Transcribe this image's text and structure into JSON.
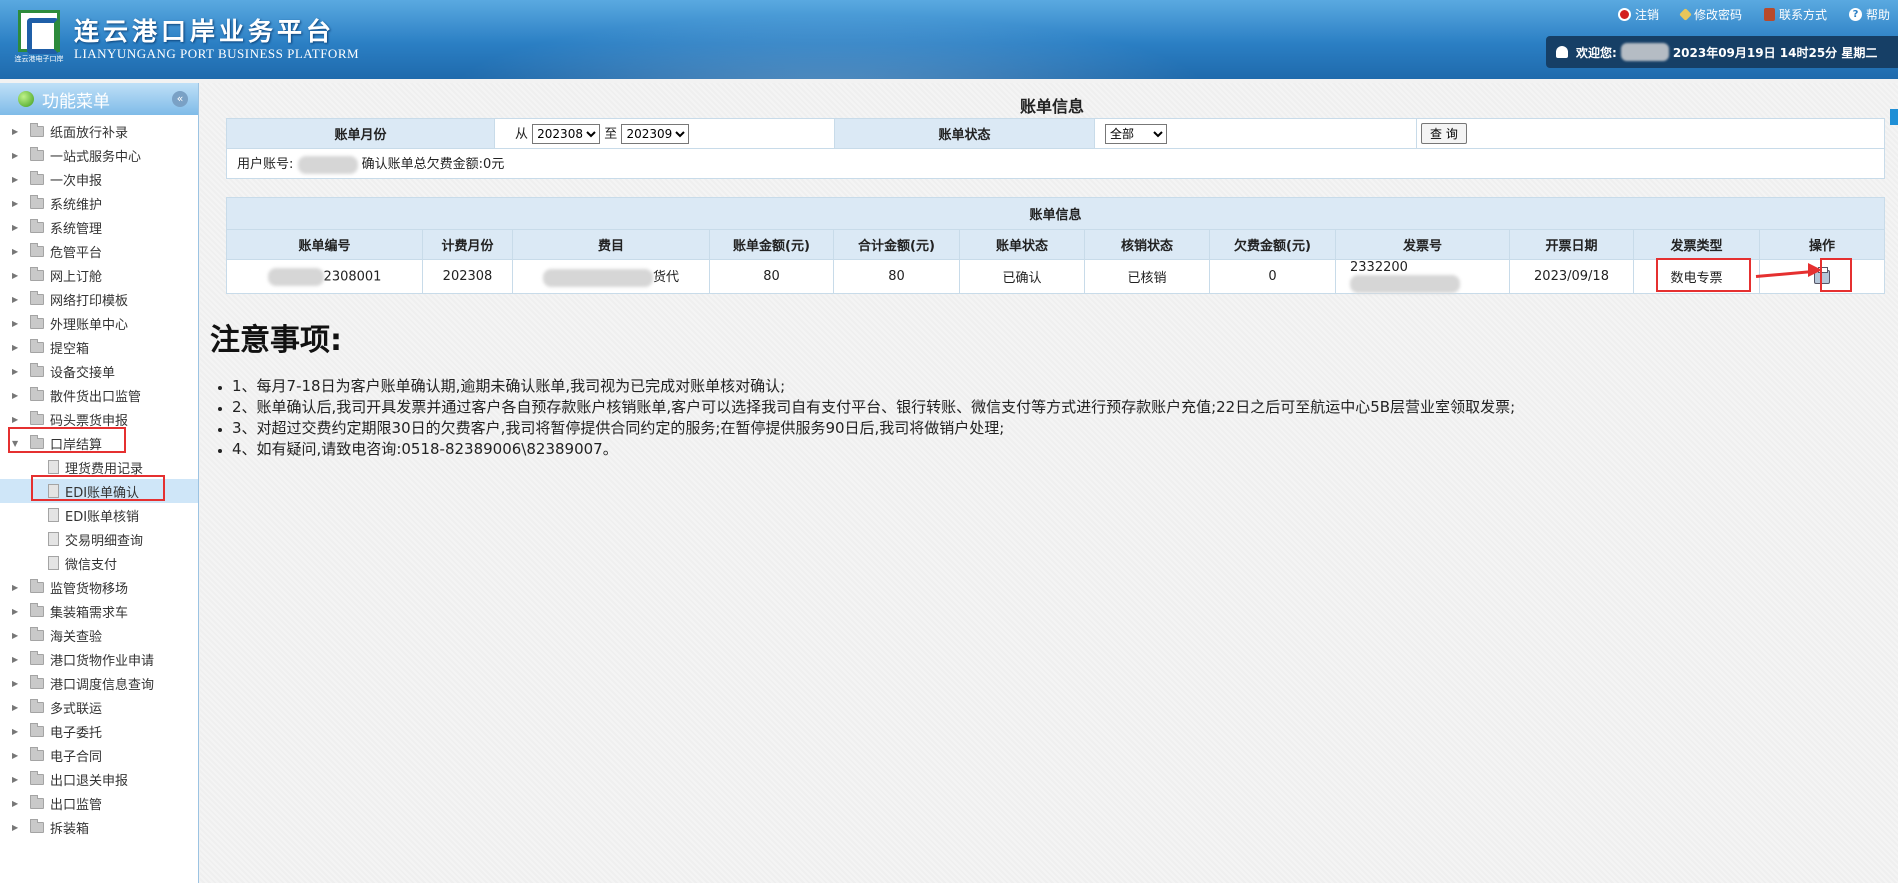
{
  "header": {
    "title_cn": "连云港口岸业务平台",
    "title_en": "LIANYUNGANG PORT BUSINESS PLATFORM",
    "logo_caption": "连云港电子口岸",
    "nav": [
      {
        "label": "注销",
        "icon": "logout-icon"
      },
      {
        "label": "修改密码",
        "icon": "key-icon"
      },
      {
        "label": "联系方式",
        "icon": "book-icon"
      },
      {
        "label": "帮助",
        "icon": "help-icon"
      }
    ],
    "welcome_label": "欢迎您:",
    "datetime": "2023年09月19日 14时25分  星期二"
  },
  "sidebar": {
    "title": "功能菜单",
    "items": [
      {
        "label": "纸面放行补录"
      },
      {
        "label": "一站式服务中心"
      },
      {
        "label": "一次申报"
      },
      {
        "label": "系统维护"
      },
      {
        "label": "系统管理"
      },
      {
        "label": "危管平台"
      },
      {
        "label": "网上订舱"
      },
      {
        "label": "网络打印模板"
      },
      {
        "label": "外理账单中心"
      },
      {
        "label": "提空箱"
      },
      {
        "label": "设备交接单"
      },
      {
        "label": "散件货出口监管"
      },
      {
        "label": "码头票货申报"
      },
      {
        "label": "口岸结算",
        "expanded": true
      },
      {
        "label": "理货费用记录",
        "child": true
      },
      {
        "label": "EDI账单确认",
        "child": true,
        "selected": true
      },
      {
        "label": "EDI账单核销",
        "child": true
      },
      {
        "label": "交易明细查询",
        "child": true
      },
      {
        "label": "微信支付",
        "child": true
      },
      {
        "label": "监管货物移场"
      },
      {
        "label": "集装箱需求车"
      },
      {
        "label": "海关查验"
      },
      {
        "label": "港口货物作业申请"
      },
      {
        "label": "港口调度信息查询"
      },
      {
        "label": "多式联运"
      },
      {
        "label": "电子委托"
      },
      {
        "label": "电子合同"
      },
      {
        "label": "出口退关申报"
      },
      {
        "label": "出口监管"
      },
      {
        "label": "拆装箱"
      }
    ]
  },
  "main": {
    "page_title": "账单信息",
    "query": {
      "month_label": "账单月份",
      "from_label": "从",
      "to_label": "至",
      "from_value": "202308",
      "to_value": "202309",
      "status_label": "账单状态",
      "status_value": "全部",
      "query_button": "查 询",
      "account_prefix": "用户账号:",
      "account_suffix": "确认账单总欠费金额:0元"
    },
    "bill_table": {
      "caption": "账单信息",
      "headers": [
        "账单编号",
        "计费月份",
        "费目",
        "账单金额(元)",
        "合计金额(元)",
        "账单状态",
        "核销状态",
        "欠费金额(元)",
        "发票号",
        "开票日期",
        "发票类型",
        "操作"
      ],
      "rows": [
        {
          "bill_no": "2308001",
          "month": "202308",
          "item": "货代",
          "amount": "80",
          "total": "80",
          "status": "已确认",
          "writeoff": "已核销",
          "owed": "0",
          "invoice_no": "2332200",
          "invoice_date": "2023/09/18",
          "invoice_type": "数电专票",
          "action_icon": "print-icon"
        }
      ]
    },
    "notice": {
      "title": "注意事项:",
      "items": [
        "1、每月7-18日为客户账单确认期,逾期未确认账单,我司视为已完成对账单核对确认;",
        "2、账单确认后,我司开具发票并通过客户各自预存款账户核销账单,客户可以选择我司自有支付平台、银行转账、微信支付等方式进行预存款账户充值;22日之后可至航运中心5B层营业室领取发票;",
        "3、对超过交费约定期限30日的欠费客户,我司将暂停提供合同约定的服务;在暂停提供服务90日后,我司将做销户处理;",
        "4、如有疑问,请致电咨询:0518-82389006\\82389007。"
      ]
    }
  },
  "colors": {
    "header_blue": "#2b7fc4",
    "table_header": "#dbe9f5",
    "highlight_red": "#e53030"
  }
}
